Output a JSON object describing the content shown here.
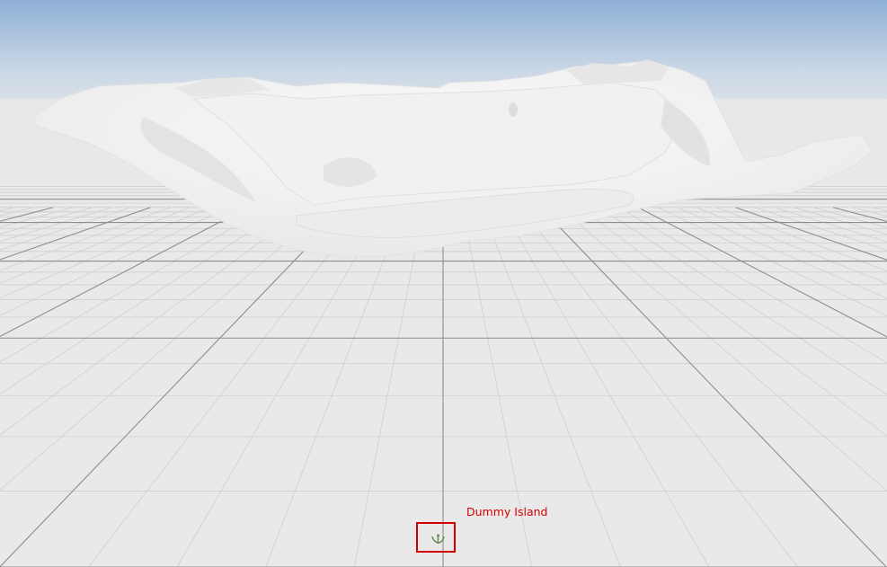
{
  "viewport": {
    "sky_top_color": "#8fb0d6",
    "horizon_color": "#e6e8ea",
    "floor_color": "#e9e9e9",
    "grid_minor_color": "#cfcfcf",
    "grid_major_color": "#8d8d8d",
    "terrain_color": "#f4f4f4",
    "terrain_shadow_color": "#dcdcdc"
  },
  "annotation": {
    "label": "Dummy Island",
    "color": "#d40000"
  },
  "actor": {
    "icon": "island-actor-icon",
    "icon_color": "#6a8a55"
  }
}
